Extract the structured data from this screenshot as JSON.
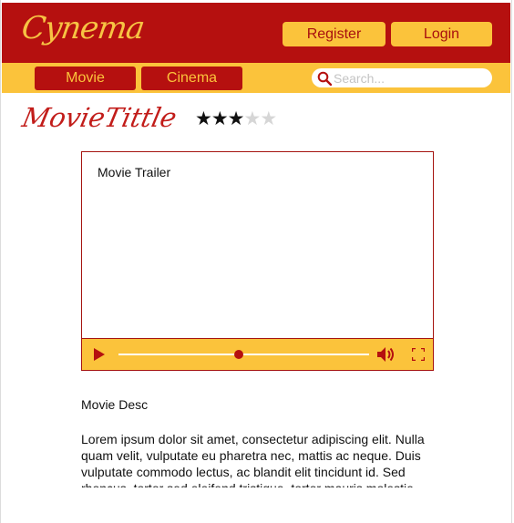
{
  "header": {
    "logo": "Cynema",
    "register_label": "Register",
    "login_label": "Login"
  },
  "nav": {
    "tabs": [
      {
        "label": "Movie"
      },
      {
        "label": "Cinema"
      }
    ],
    "search": {
      "placeholder": "Search...",
      "value": ""
    }
  },
  "movie": {
    "title": "MovieTittle",
    "rating": {
      "value": 3,
      "max": 5
    },
    "trailer_label": "Movie Trailer",
    "player": {
      "progress_fraction": 0.48
    },
    "desc_title": "Movie Desc",
    "desc_body": "Lorem ipsum dolor sit amet, consectetur adipiscing elit. Nulla quam velit, vulputate eu pharetra nec, mattis ac neque. Duis vulputate commodo lectus, ac blandit elit tincidunt id. Sed rhoncus, tortor sed eleifend tristique, tortor mauris molestie elit, et lacinia ipsum quam nec dui."
  },
  "colors": {
    "brand_red": "#b5100f",
    "brand_yellow": "#fbc33b"
  }
}
